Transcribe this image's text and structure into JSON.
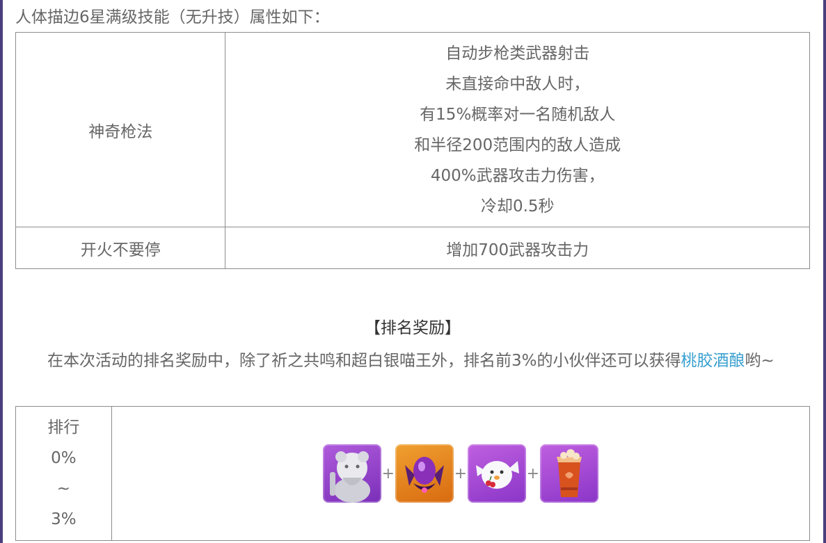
{
  "intro": "人体描边6星满级技能（无升技）属性如下：",
  "skills": [
    {
      "name": "神奇枪法",
      "description": [
        "自动步枪类武器射击",
        "未直接命中敌人时，",
        "有15%概率对一名随机敌人",
        "和半径200范围内的敌人造成",
        "400%武器攻击力伤害，",
        "冷却0.5秒"
      ]
    },
    {
      "name": "开火不要停",
      "description": [
        "增加700武器攻击力"
      ]
    }
  ],
  "ranking": {
    "title": "【排名奖励】",
    "paragraph": "在本次活动的排名奖励中，除了祈之共鸣和超白银喵王外，排名前3%的小伙伴还可以获得",
    "link": "桃胶酒酿",
    "suffix": "哟~",
    "table": {
      "rank_lines": [
        "排行",
        "0%",
        "~",
        "3%"
      ],
      "items": [
        {
          "icon": "white-statue-figure-icon",
          "color": "#8a3fc8"
        },
        {
          "icon": "purple-gem-crest-icon",
          "color": "#e07a18"
        },
        {
          "icon": "white-bird-with-cherry-icon",
          "color": "#a047d6"
        },
        {
          "icon": "peach-drink-cup-icon",
          "color": "#a047d6"
        }
      ],
      "separator": "+"
    }
  }
}
